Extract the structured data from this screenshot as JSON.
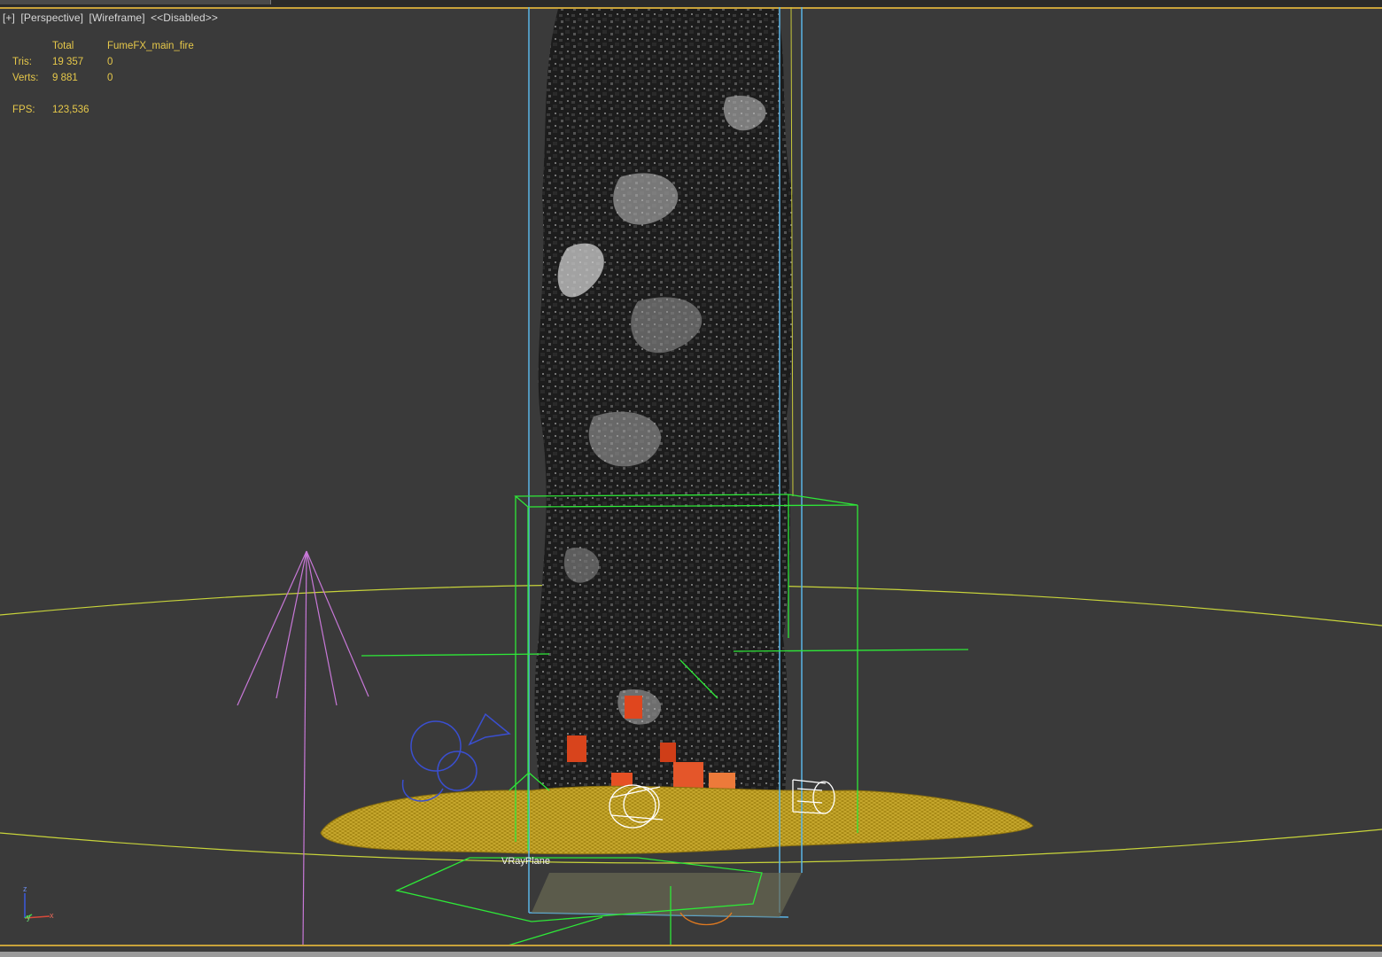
{
  "viewport": {
    "label_items": [
      "[+]",
      "[Perspective]",
      "[Wireframe]",
      "<<Disabled>>"
    ]
  },
  "stats": {
    "header": {
      "c1": "Total",
      "c2": "FumeFX_main_fire"
    },
    "tris": {
      "label": "Tris:",
      "total": "19 357",
      "object": "0"
    },
    "verts": {
      "label": "Verts:",
      "total": "9 881",
      "object": "0"
    },
    "fps": {
      "label": "FPS:",
      "value": "123,536"
    }
  },
  "scene": {
    "object_label": "VRayPlane",
    "axis_labels": {
      "z": "z",
      "y": "y",
      "x": "x"
    }
  },
  "colors": {
    "stats_text": "#e6c84a",
    "ground_plane": "#b0901a",
    "bounding_box": "#5ab4e6",
    "fume_box": "#2ee838",
    "light": "#c878d8",
    "camera": "#3a4fd0",
    "horizon_ring": "#c8d43a"
  }
}
